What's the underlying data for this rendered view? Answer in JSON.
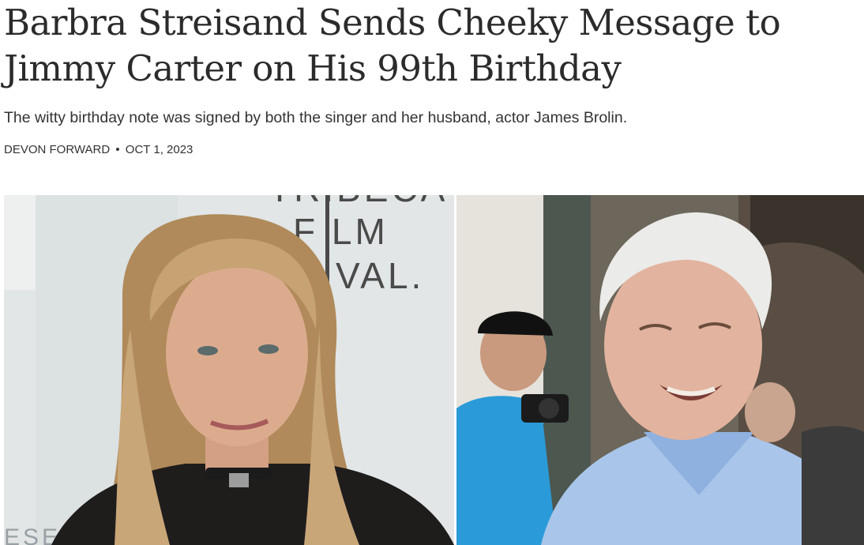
{
  "article": {
    "headline": "Barbra Streisand Sends Cheeky Message to Jimmy Carter on His 99th Birthday",
    "dek": "The witty birthday note was signed by both the singer and her husband, actor James Brolin.",
    "author": "DEVON FORWARD",
    "separator": "•",
    "date": "OCT 1, 2023"
  },
  "hero_image": {
    "backdrop_text": {
      "line1": "TRIBECA",
      "line2": "F LM",
      "line3": "VAL.",
      "bottom": "ESENT"
    },
    "colors": {
      "left_bg": "#dfe3e4",
      "right_bg": "#6f6a5e",
      "skin": "#d9a88a",
      "hair_blonde": "#b89464",
      "shirt_blue": "#a9c6ea",
      "white_hair": "#e6e6e4"
    }
  }
}
